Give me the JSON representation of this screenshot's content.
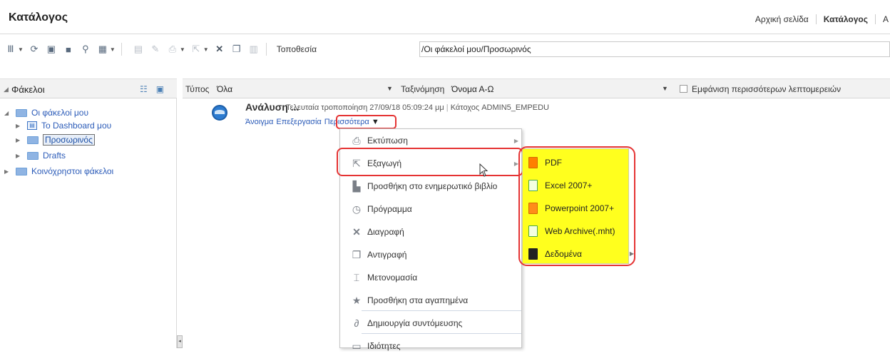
{
  "header": {
    "app_title": "Κατάλογος",
    "nav": [
      "Αρχική σελίδα",
      "Κατάλογος",
      "Α"
    ]
  },
  "toolbar": {
    "location_label": "Τοποθεσία",
    "location_value": "/Οι φάκελοί μου/Προσωρινός",
    "icons": [
      "view-icon",
      "refresh-icon",
      "new-folder-icon",
      "open-folder-icon",
      "search-icon",
      "new-item-icon",
      "properties-icon",
      "edit-icon",
      "print-icon",
      "export-icon",
      "delete-icon",
      "copy-icon",
      "paste-icon"
    ]
  },
  "folders_pane": {
    "title": "Φάκελοι",
    "tree": [
      {
        "label": "Οι φάκελοί μου",
        "expanded": true
      },
      {
        "label": "To Dashboard μου"
      },
      {
        "label": "Προσωρινός",
        "selected": true
      },
      {
        "label": "Drafts"
      },
      {
        "label": "Κοινόχρηστοι φάκελοι"
      }
    ]
  },
  "filters": {
    "type_label": "Τύπος",
    "type_value": "Όλα",
    "sort_label": "Ταξινόμηση",
    "sort_value": "Όνομα Α-Ω",
    "details_label": "Εμφάνιση περισσότερων λεπτομερειών"
  },
  "item": {
    "title": "Ανάλυση ...",
    "modified": "Τελευταία τροποποίηση 27/09/18 05:09:24 μμ",
    "owner": "Κάτοχος ADMIN5_EMPEDU",
    "actions": [
      "Άνοιγμα",
      "Επεξεργασία",
      "Περισσότερα"
    ],
    "more_caret": "▼"
  },
  "context_menu": [
    {
      "label": "Εκτύπωση",
      "icon": "print-icon",
      "submenu": true
    },
    {
      "label": "Εξαγωγή",
      "icon": "export-icon",
      "submenu": true
    },
    {
      "label": "Προσθήκη στο ενημερωτικό βιβλίο",
      "icon": "briefing-book-icon"
    },
    {
      "label": "Πρόγραμμα",
      "icon": "schedule-icon"
    },
    {
      "label": "Διαγραφή",
      "icon": "delete-icon"
    },
    {
      "label": "Αντιγραφή",
      "icon": "copy-icon"
    },
    {
      "label": "Μετονομασία",
      "icon": "rename-icon"
    },
    {
      "label": "Προσθήκη στα αγαπημένα",
      "icon": "favorite-icon"
    },
    {
      "label": "Δημιουργία συντόμευσης",
      "icon": "shortcut-icon"
    },
    {
      "label": "Ιδιότητες",
      "icon": "properties-icon"
    }
  ],
  "export_submenu": [
    {
      "label": "PDF",
      "icon": "pdf-icon"
    },
    {
      "label": "Excel 2007+",
      "icon": "excel-icon"
    },
    {
      "label": "Powerpoint 2007+",
      "icon": "powerpoint-icon"
    },
    {
      "label": "Web Archive(.mht)",
      "icon": "web-archive-icon"
    },
    {
      "label": "Δεδομένα",
      "icon": "data-icon",
      "submenu": true
    }
  ],
  "colors": {
    "highlight": "#ffff1e",
    "annotation": "#e53333",
    "link": "#2b5bb8"
  }
}
